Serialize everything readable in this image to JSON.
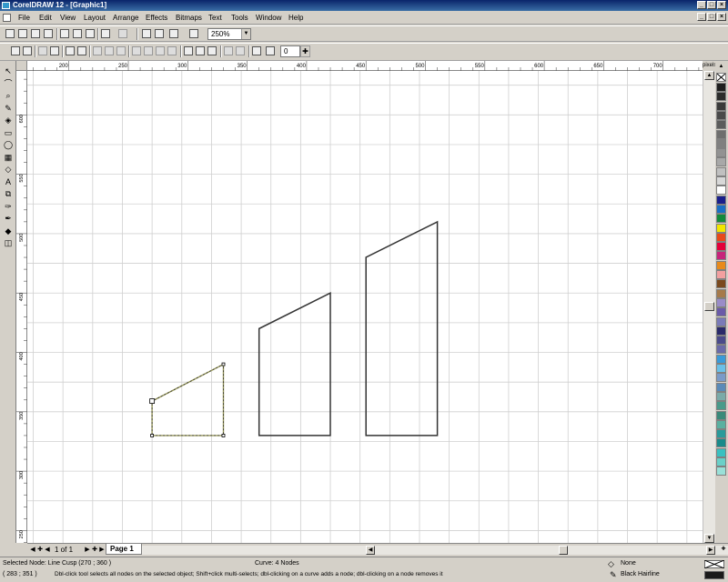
{
  "window": {
    "title": "CorelDRAW 12 - [Graphic1]",
    "minimize": "_",
    "maximize": "□",
    "close": "×"
  },
  "menu": [
    "File",
    "Edit",
    "View",
    "Layout",
    "Arrange",
    "Effects",
    "Bitmaps",
    "Text",
    "Tools",
    "Window",
    "Help"
  ],
  "toolbar": {
    "zoom_level": "250%",
    "nudge_value": "0"
  },
  "rulers": {
    "unit": "pixels",
    "h_ticks": [
      "200",
      "250",
      "300",
      "350",
      "400",
      "450",
      "500",
      "550",
      "600",
      "650",
      "700"
    ],
    "v_ticks": [
      "600",
      "550",
      "500",
      "450",
      "400",
      "350",
      "300",
      "250"
    ]
  },
  "pages": {
    "counter": "1 of 1",
    "tab": "Page 1"
  },
  "palette": [
    "#1e1e1e",
    "#2c2c2c",
    "#3a3a3a",
    "#4a4a4a",
    "#5c5c5c",
    "#6e6e6e",
    "#808080",
    "#929292",
    "#a8a8a8",
    "#c0c0c0",
    "#d8d8d8",
    "#ffffff",
    "#1a1f8c",
    "#1a6fc4",
    "#128a3c",
    "#f2e600",
    "#e8491b",
    "#e4003a",
    "#c7247a",
    "#e88a1a",
    "#f2a0a0",
    "#7a4a1e",
    "#a67a4a",
    "#9a8cc8",
    "#6a5aa8",
    "#7a7ab8",
    "#2a2a6a",
    "#4a4a8a",
    "#6a6aa8",
    "#3a9ad8",
    "#6ac0e8",
    "#7a9ac8",
    "#5a8ab8",
    "#7aaaa8",
    "#4a9a8a",
    "#3a8a7a",
    "#5ab0a0",
    "#2a9a9a",
    "#1a8a8a",
    "#3ac0c0",
    "#6ad0c8",
    "#9ae0d8"
  ],
  "status": {
    "selection": "Selected Node: Line Cusp (270 ; 360 )",
    "curve": "Curve: 4 Nodes",
    "coords": "( 283 ; 351 )",
    "hint": "Dbl-click tool selects all nodes on the selected object; Shift+click multi-selects; dbl-clicking on a curve adds a node; dbl-clicking on a node removes it",
    "fill_label": "None",
    "outline_label": "Black  Hairline",
    "fill_color": "#ffffff",
    "outline_color": "#1a1a1a"
  },
  "colors": {
    "chrome": "#d4d0c8",
    "title_start": "#0a246a",
    "title_end": "#3a6ea5",
    "grid": "#d0d0d0",
    "shape": "#333333",
    "selected_shape": "#9a9a5a"
  },
  "icons": [
    "pick-tool",
    "shape-tool",
    "zoom-tool",
    "freehand-tool",
    "smart-fill-tool",
    "rectangle-tool",
    "ellipse-tool",
    "graph-paper-tool",
    "basic-shapes-tool",
    "text-tool",
    "interactive-blend-tool",
    "eyedropper-tool",
    "outline-tool",
    "fill-tool",
    "interactive-fill-tool"
  ]
}
